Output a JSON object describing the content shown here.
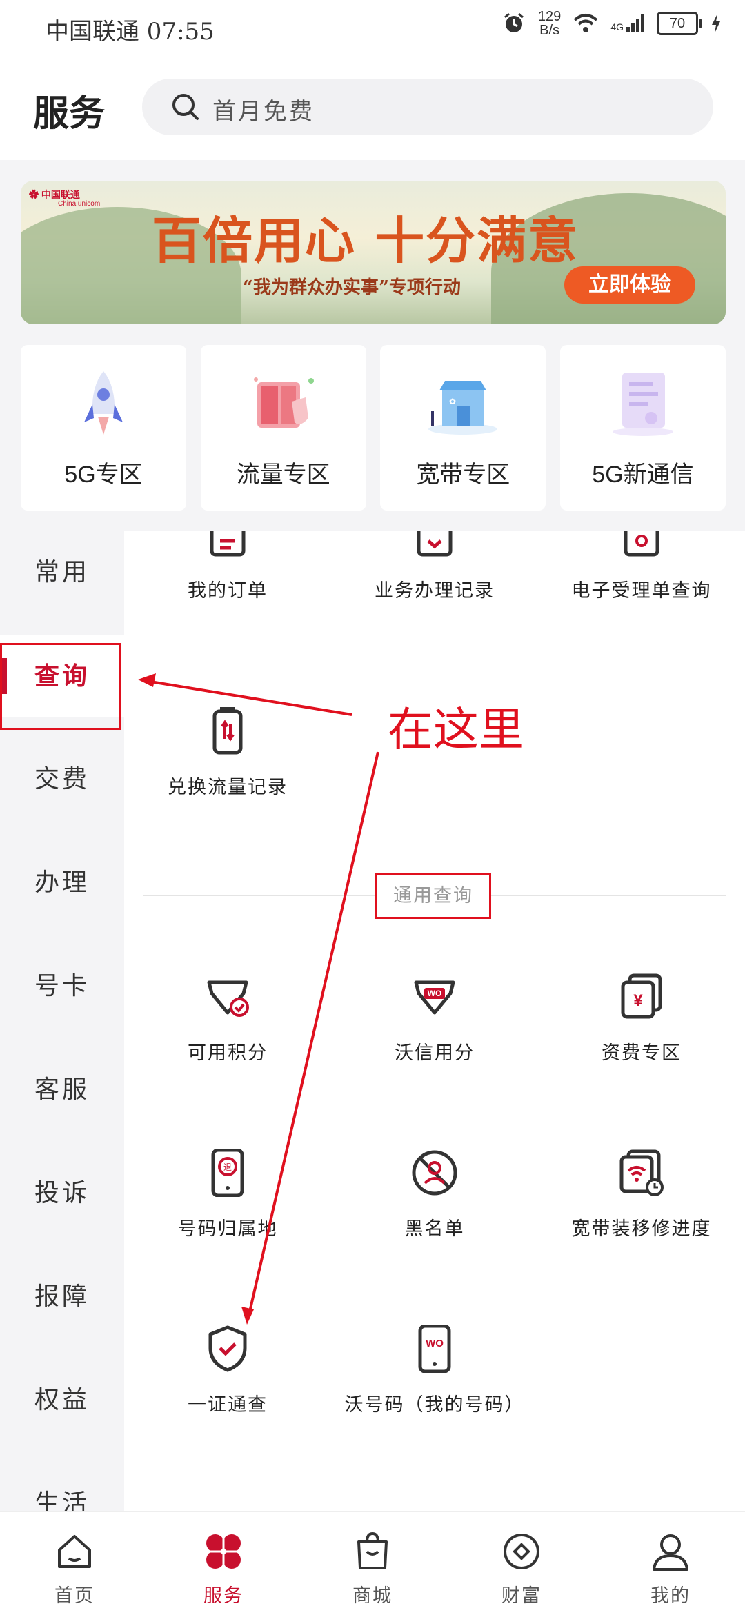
{
  "status_bar": {
    "carrier_time": "中国联通 07:55",
    "net_speed_value": "129",
    "net_speed_unit": "B/s",
    "network": "4G",
    "battery": "70"
  },
  "header": {
    "title": "服务",
    "search_placeholder": "首月免费"
  },
  "banner": {
    "brand": "中国联通",
    "brand_en": "China unicom",
    "slogan": "百倍用心 十分满意",
    "subtitle": "“我为群众办实事”专项行动",
    "cta": "立即体验"
  },
  "quick_cards": [
    {
      "label": "5G专区",
      "icon": "rocket-icon"
    },
    {
      "label": "流量专区",
      "icon": "data-cabinet-icon"
    },
    {
      "label": "宽带专区",
      "icon": "broadband-store-icon"
    },
    {
      "label": "5G新通信",
      "icon": "new-message-icon"
    }
  ],
  "sidebar": {
    "items": [
      {
        "label": "常用"
      },
      {
        "label": "查询",
        "active": true
      },
      {
        "label": "交费"
      },
      {
        "label": "办理"
      },
      {
        "label": "号卡"
      },
      {
        "label": "客服"
      },
      {
        "label": "投诉"
      },
      {
        "label": "报障"
      },
      {
        "label": "权益"
      },
      {
        "label": "生活"
      }
    ]
  },
  "content": {
    "row1": [
      {
        "label": "我的订单",
        "icon": "order-icon"
      },
      {
        "label": "业务办理记录",
        "icon": "record-icon"
      },
      {
        "label": "电子受理单查询",
        "icon": "receipt-icon"
      }
    ],
    "row2": [
      {
        "label": "兑换流量记录",
        "icon": "data-exchange-icon"
      }
    ],
    "section_title": "通用查询",
    "general": [
      {
        "label": "可用积分",
        "icon": "points-icon"
      },
      {
        "label": "沃信用分",
        "icon": "wo-credit-icon"
      },
      {
        "label": "资费专区",
        "icon": "tariff-icon"
      },
      {
        "label": "号码归属地",
        "icon": "number-location-icon"
      },
      {
        "label": "黑名单",
        "icon": "blacklist-icon"
      },
      {
        "label": "宽带装移修进度",
        "icon": "broadband-progress-icon"
      },
      {
        "label": "一证通查",
        "icon": "id-check-icon"
      },
      {
        "label": "沃号码（我的号码）",
        "icon": "wo-number-icon"
      }
    ]
  },
  "annotation": {
    "text": "在这里"
  },
  "tabbar": {
    "items": [
      {
        "label": "首页",
        "icon": "home-icon"
      },
      {
        "label": "服务",
        "icon": "service-icon",
        "active": true
      },
      {
        "label": "商城",
        "icon": "shopping-bag-icon"
      },
      {
        "label": "财富",
        "icon": "wealth-icon"
      },
      {
        "label": "我的",
        "icon": "profile-icon"
      }
    ]
  },
  "colors": {
    "accent": "#c8102e",
    "annotation": "#e0101e"
  }
}
